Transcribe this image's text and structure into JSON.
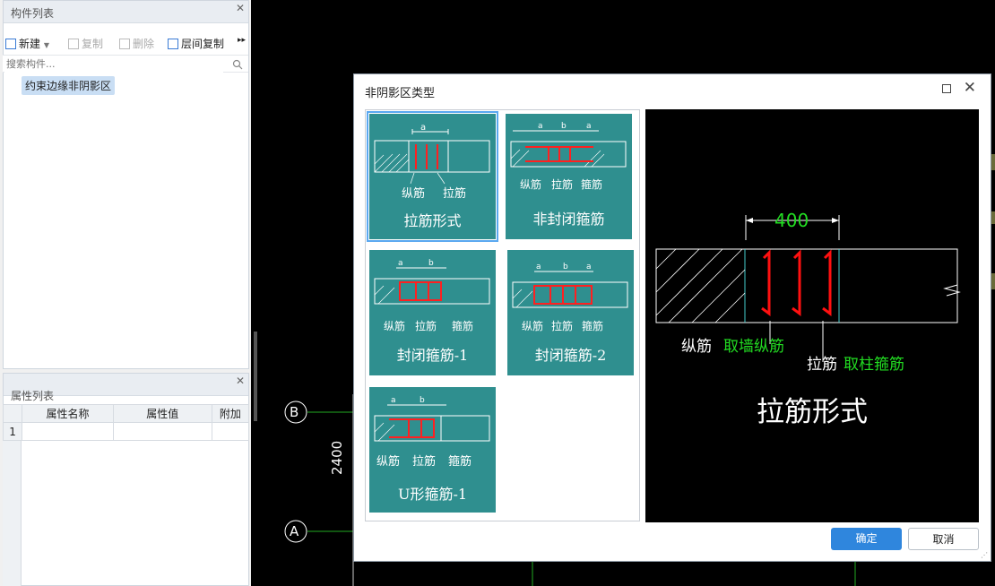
{
  "component_panel": {
    "title": "构件列表",
    "toolbar": {
      "new": "新建",
      "copy": "复制",
      "delete": "删除",
      "floor_copy": "层间复制"
    },
    "search_placeholder": "搜索构件...",
    "items": [
      "约束边缘非阴影区"
    ]
  },
  "property_panel": {
    "title": "属性列表",
    "columns": [
      "属性名称",
      "属性值",
      "附加"
    ],
    "rows": [
      "1"
    ]
  },
  "cad": {
    "axis_b": "B",
    "axis_a": "A",
    "dimension": "2400"
  },
  "dialog": {
    "title": "非阴影区类型",
    "types": [
      {
        "label": "拉筋形式",
        "parts": [
          "纵筋",
          "拉筋"
        ],
        "dims": [
          "a"
        ]
      },
      {
        "label": "非封闭箍筋",
        "parts": [
          "纵筋",
          "拉筋",
          "箍筋"
        ],
        "dims": [
          "a",
          "b",
          "a"
        ]
      },
      {
        "label": "封闭箍筋-1",
        "parts": [
          "纵筋",
          "拉筋",
          "箍筋"
        ],
        "dims": [
          "a",
          "b"
        ]
      },
      {
        "label": "封闭箍筋-2",
        "parts": [
          "纵筋",
          "拉筋",
          "箍筋"
        ],
        "dims": [
          "a",
          "b",
          "a"
        ]
      },
      {
        "label": "U形箍筋-1",
        "parts": [
          "纵筋",
          "拉筋",
          "箍筋"
        ],
        "dims": [
          "a",
          "b"
        ]
      }
    ],
    "selected_index": 0,
    "preview": {
      "dimension": "400",
      "label1": "纵筋",
      "label1_note": "取墙纵筋",
      "label2": "拉筋",
      "label2_note": "取柱箍筋",
      "title": "拉筋形式"
    },
    "ok": "确定",
    "cancel": "取消"
  },
  "colors": {
    "tile": "#2f8f8f",
    "primary": "#2f86dd",
    "rebar": "#ff0000",
    "green_note": "#22cc22"
  }
}
